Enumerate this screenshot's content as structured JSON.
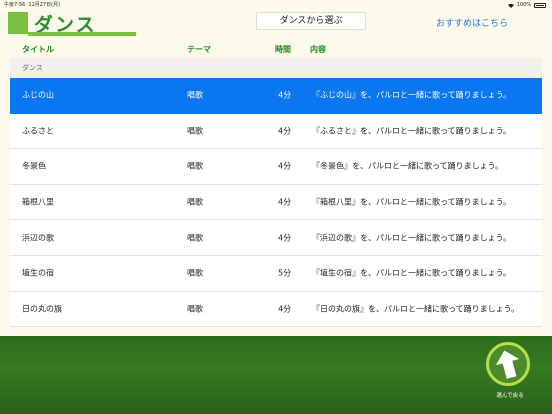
{
  "status": {
    "time": "午後7:56",
    "date": "12月27日(月)",
    "battery": "100%"
  },
  "header": {
    "title": "ダンス",
    "selector": "ダンスから選ぶ",
    "recommend": "おすすめはこちら"
  },
  "columns": {
    "title": "タイトル",
    "theme": "テーマ",
    "time": "時間",
    "content": "内容"
  },
  "section": "ダンス",
  "rows": [
    {
      "title": "ふじの山",
      "theme": "唱歌",
      "time": "4分",
      "content": "『ふじの山』を、パルロと一緒に歌って踊りましょう。"
    },
    {
      "title": "ふるさと",
      "theme": "唱歌",
      "time": "4分",
      "content": "『ふるさと』を、パルロと一緒に歌って踊りましょう。"
    },
    {
      "title": "冬景色",
      "theme": "唱歌",
      "time": "4分",
      "content": "『冬景色』を、パルロと一緒に歌って踊りましょう。"
    },
    {
      "title": "箱根八里",
      "theme": "唱歌",
      "time": "4分",
      "content": "『箱根八里』を、パルロと一緒に歌って踊りましょう。"
    },
    {
      "title": "浜辺の歌",
      "theme": "唱歌",
      "time": "4分",
      "content": "『浜辺の歌』を、パルロと一緒に歌って踊りましょう。"
    },
    {
      "title": "埴生の宿",
      "theme": "唱歌",
      "time": "5分",
      "content": "『埴生の宿』を、パルロと一緒に歌って踊りましょう。"
    },
    {
      "title": "日の丸の旗",
      "theme": "唱歌",
      "time": "4分",
      "content": "『日の丸の旗』を、パルロと一緒に歌って踊りましょう。"
    }
  ],
  "footer": {
    "back_label": "選んで戻る"
  },
  "colors": {
    "accent_green": "#7ac143",
    "title_green": "#2e8b2e",
    "selected_blue": "#0a76f0",
    "link_blue": "#1e7fd6"
  }
}
